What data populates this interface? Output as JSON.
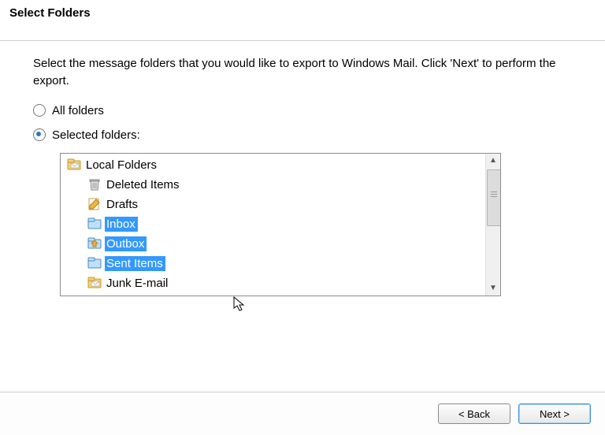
{
  "header": {
    "title": "Select Folders"
  },
  "instruction": "Select the message folders that you would like to export to Windows Mail. Click 'Next' to perform the export.",
  "options": {
    "all": {
      "label": "All folders",
      "checked": false
    },
    "selected": {
      "label": "Selected folders:",
      "checked": true
    }
  },
  "tree": {
    "root": {
      "label": "Local Folders",
      "icon": "folder-root-icon"
    },
    "items": [
      {
        "label": "Deleted Items",
        "icon": "trash-icon",
        "selected": false
      },
      {
        "label": "Drafts",
        "icon": "draft-icon",
        "selected": false
      },
      {
        "label": "Inbox",
        "icon": "inbox-icon",
        "selected": true
      },
      {
        "label": "Outbox",
        "icon": "outbox-icon",
        "selected": true
      },
      {
        "label": "Sent Items",
        "icon": "sent-icon",
        "selected": true
      },
      {
        "label": "Junk E-mail",
        "icon": "junk-icon",
        "selected": false
      }
    ]
  },
  "buttons": {
    "back": "< Back",
    "next": "Next >"
  }
}
